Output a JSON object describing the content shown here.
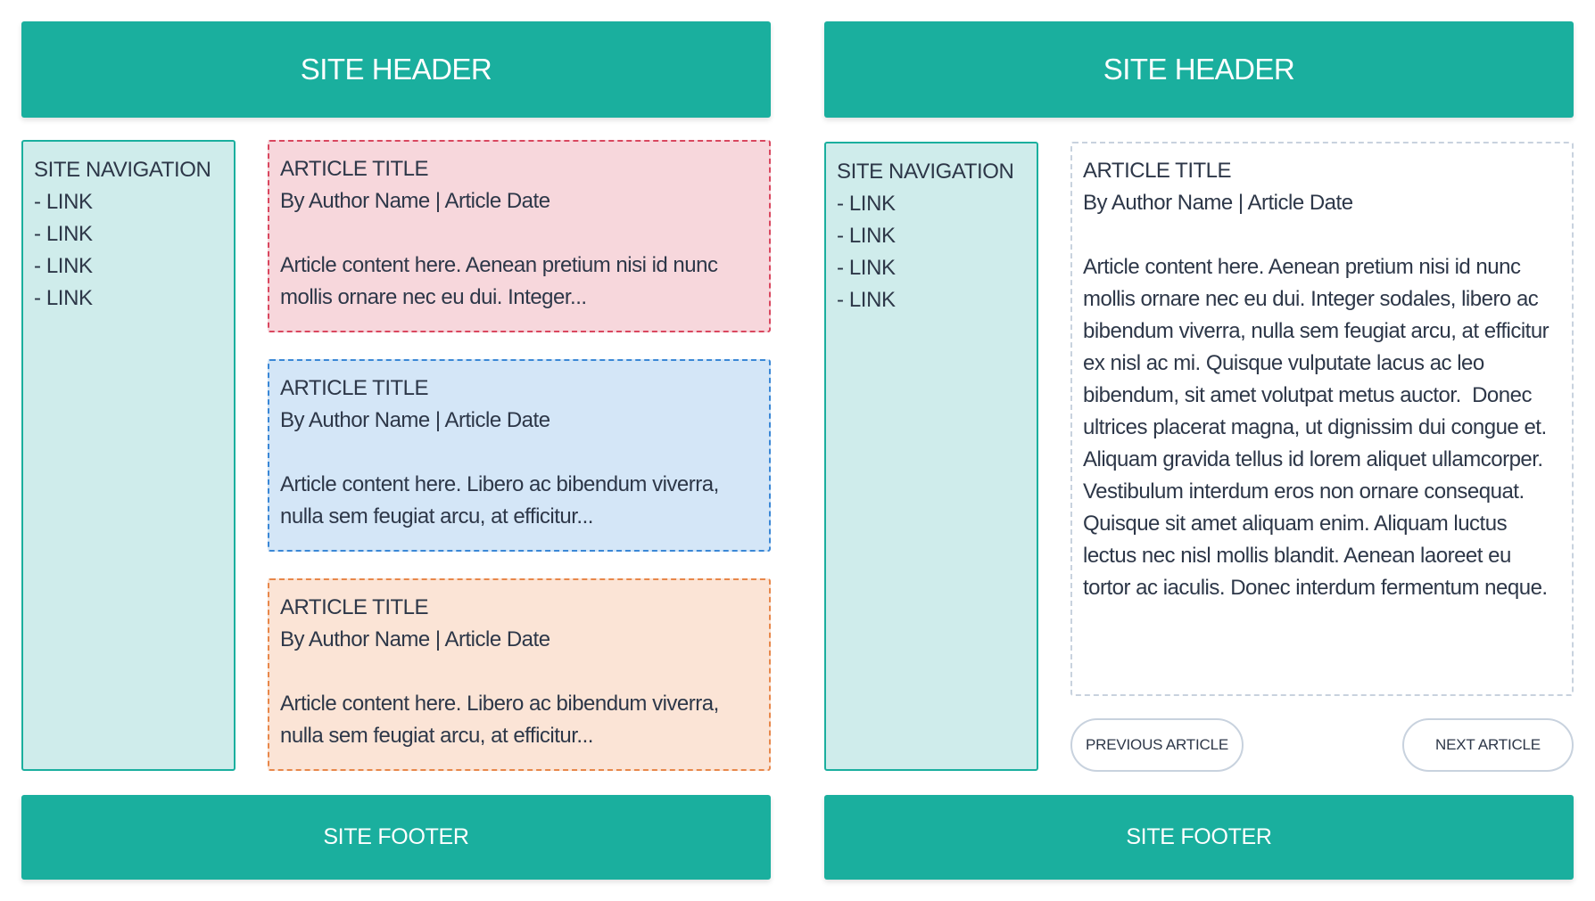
{
  "colors": {
    "accent": "#1aaf9e",
    "nav_bg": "#cfeceb",
    "pink": "#f7d7dc",
    "blue": "#d4e6f7",
    "orange": "#fbe4d6"
  },
  "left": {
    "header": "SITE HEADER",
    "nav": {
      "title": "SITE NAVIGATION",
      "links": [
        "- LINK",
        "- LINK",
        "- LINK",
        "- LINK"
      ]
    },
    "articles": [
      {
        "title": "ARTICLE TITLE",
        "byline": "By Author Name | Article Date",
        "content": "Article content here. Aenean pretium nisi id nunc mollis ornare nec eu dui. Integer..."
      },
      {
        "title": "ARTICLE TITLE",
        "byline": "By Author Name | Article Date",
        "content": "Article content here. Libero ac bibendum viverra, nulla sem feugiat arcu, at efficitur..."
      },
      {
        "title": "ARTICLE TITLE",
        "byline": "By Author Name | Article Date",
        "content": "Article content here. Libero ac bibendum viverra, nulla sem feugiat arcu, at efficitur..."
      }
    ],
    "footer": "SITE FOOTER"
  },
  "right": {
    "header": "SITE HEADER",
    "nav": {
      "title": "SITE NAVIGATION",
      "links": [
        "- LINK",
        "- LINK",
        "- LINK",
        "- LINK"
      ]
    },
    "article": {
      "title": "ARTICLE TITLE",
      "byline": "By Author Name | Article Date",
      "content": "Article content here. Aenean pretium nisi id nunc mollis ornare nec eu dui. Integer sodales, libero ac bibendum viverra, nulla sem feugiat arcu, at efficitur ex nisl ac mi. Quisque vulputate lacus ac leo bibendum, sit amet volutpat metus auctor.  Donec ultrices placerat magna, ut dignissim dui congue et. Aliquam gravida tellus id lorem aliquet ullamcorper. Vestibulum interdum eros non ornare consequat. Quisque sit amet aliquam enim. Aliquam luctus lectus nec nisl mollis blandit. Aenean laoreet eu tortor ac iaculis. Donec interdum fermentum neque."
    },
    "prev_label": "PREVIOUS ARTICLE",
    "next_label": "NEXT ARTICLE",
    "footer": "SITE FOOTER"
  }
}
